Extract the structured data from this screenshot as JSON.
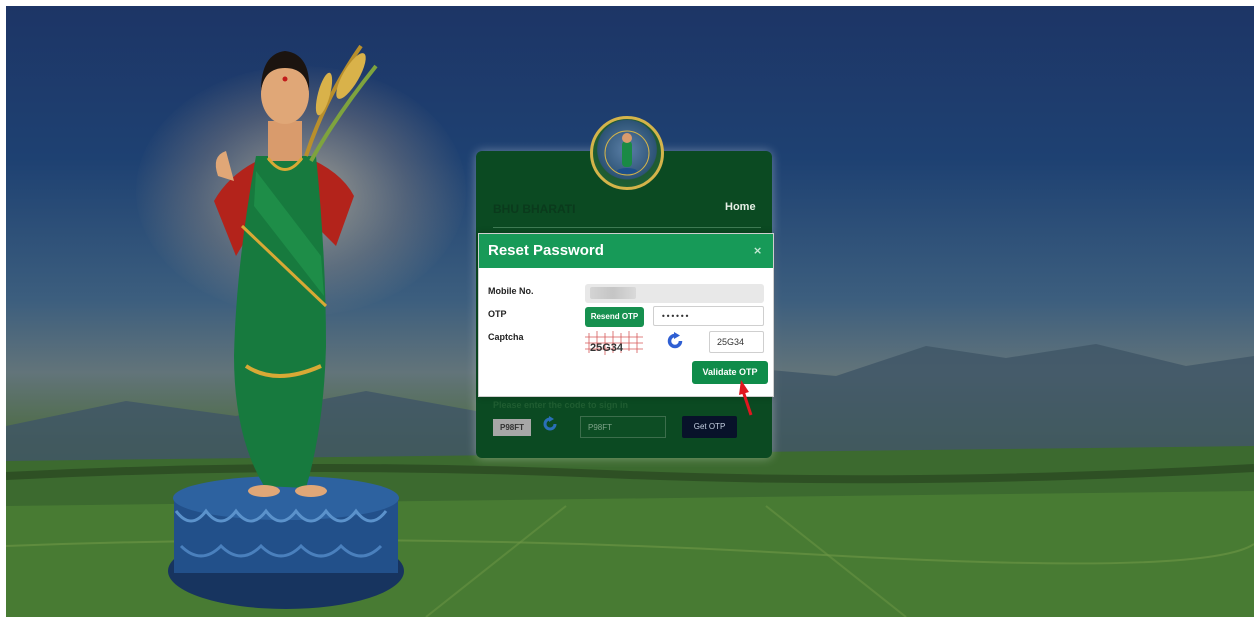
{
  "login_card": {
    "brand": "BHU BHARATI",
    "nav_home": "Home",
    "hint": "Please enter the code to sign in",
    "captcha_image_text": "P98FT",
    "captcha_value": "P98FT",
    "get_otp_label": "Get OTP"
  },
  "modal": {
    "title": "Reset Password",
    "close_glyph": "×",
    "mobile_label": "Mobile No.",
    "otp_label": "OTP",
    "captcha_label": "Captcha",
    "resend_label": "Resend OTP",
    "otp_value": "••••••",
    "captcha_image_text": "25G34",
    "captcha_value": "25G34",
    "validate_label": "Validate OTP"
  },
  "colors": {
    "accent_green": "#179a58",
    "card_green": "#0b4a22",
    "arrow_red": "#e0171f"
  },
  "icons": [
    "refresh-icon",
    "close-icon",
    "emblem-seal"
  ]
}
